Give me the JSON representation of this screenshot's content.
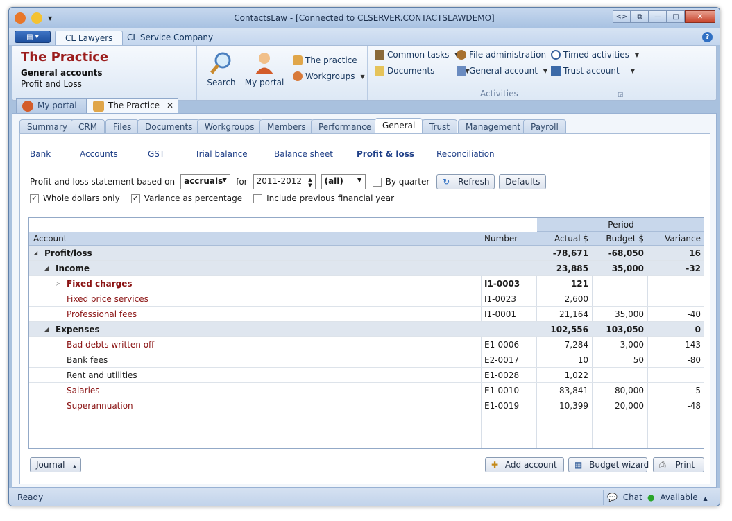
{
  "window": {
    "title": "ContactsLaw - [Connected to CLSERVER.CONTACTSLAWDEMO]"
  },
  "ribbon_tabs": [
    "CL Lawyers",
    "CL Service Company"
  ],
  "context": {
    "title": "The Practice",
    "subtitle": "General accounts",
    "subtitle2": "Profit and Loss"
  },
  "ribbon": {
    "search": "Search",
    "my_portal": "My portal",
    "the_practice": "The practice",
    "workgroups": "Workgroups",
    "common_tasks": "Common tasks",
    "documents": "Documents",
    "file_administration": "File administration",
    "general_account": "General account",
    "timed_activities": "Timed activities",
    "trust_account": "Trust account",
    "activities_label": "Activities"
  },
  "doc_tabs": [
    "My portal",
    "The Practice"
  ],
  "sub_tabs": [
    "Summary",
    "CRM",
    "Files",
    "Documents",
    "Workgroups",
    "Members",
    "Performance",
    "General",
    "Trust",
    "Management",
    "Payroll"
  ],
  "links": [
    "Bank",
    "Accounts",
    "GST",
    "Trial balance",
    "Balance sheet",
    "Profit & loss",
    "Reconciliation"
  ],
  "filters": {
    "label": "Profit and loss statement based on",
    "basis": "accruals",
    "for_label": "for",
    "year": "2011-2012",
    "scope": "(all)",
    "by_quarter": "By quarter",
    "refresh": "Refresh",
    "defaults": "Defaults",
    "whole_dollars": "Whole dollars only",
    "variance_pct": "Variance as percentage",
    "include_prev": "Include previous financial year"
  },
  "grid": {
    "period_header": "Period",
    "columns": [
      "Account",
      "Number",
      "Actual $",
      "Budget $",
      "Variance"
    ],
    "rows": [
      {
        "indent": 0,
        "group": true,
        "expander": "◢",
        "account": "Profit/loss",
        "number": "",
        "actual": "-78,671",
        "budget": "-68,050",
        "variance": "16"
      },
      {
        "indent": 1,
        "group": true,
        "expander": "◢",
        "account": "Income",
        "number": "",
        "actual": "23,885",
        "budget": "35,000",
        "variance": "-32"
      },
      {
        "indent": 2,
        "group": false,
        "bold": true,
        "red": true,
        "expander": "▷",
        "account": "Fixed charges",
        "number": "I1-0003",
        "actual": "121",
        "budget": "",
        "variance": ""
      },
      {
        "indent": 2,
        "group": false,
        "red": true,
        "expander": "",
        "account": "Fixed price services",
        "number": "I1-0023",
        "actual": "2,600",
        "budget": "",
        "variance": ""
      },
      {
        "indent": 2,
        "group": false,
        "red": true,
        "expander": "",
        "account": "Professional fees",
        "number": "I1-0001",
        "actual": "21,164",
        "budget": "35,000",
        "variance": "-40"
      },
      {
        "indent": 1,
        "group": true,
        "expander": "◢",
        "account": "Expenses",
        "number": "",
        "actual": "102,556",
        "budget": "103,050",
        "variance": "0"
      },
      {
        "indent": 2,
        "group": false,
        "red": true,
        "expander": "",
        "account": "Bad debts written off",
        "number": "E1-0006",
        "actual": "7,284",
        "budget": "3,000",
        "variance": "143"
      },
      {
        "indent": 2,
        "group": false,
        "red": false,
        "expander": "",
        "account": "Bank fees",
        "number": "E2-0017",
        "actual": "10",
        "budget": "50",
        "variance": "-80"
      },
      {
        "indent": 2,
        "group": false,
        "red": false,
        "expander": "",
        "account": "Rent and utilities",
        "number": "E1-0028",
        "actual": "1,022",
        "budget": "",
        "variance": ""
      },
      {
        "indent": 2,
        "group": false,
        "red": true,
        "expander": "",
        "account": "Salaries",
        "number": "E1-0010",
        "actual": "83,841",
        "budget": "80,000",
        "variance": "5"
      },
      {
        "indent": 2,
        "group": false,
        "red": true,
        "expander": "",
        "account": "Superannuation",
        "number": "E1-0019",
        "actual": "10,399",
        "budget": "20,000",
        "variance": "-48"
      }
    ]
  },
  "bottom": {
    "journal": "Journal",
    "add_account": "Add account",
    "budget_wizard": "Budget wizard",
    "print": "Print"
  },
  "status": {
    "text": "Ready",
    "chat": "Chat",
    "availability": "Available"
  }
}
